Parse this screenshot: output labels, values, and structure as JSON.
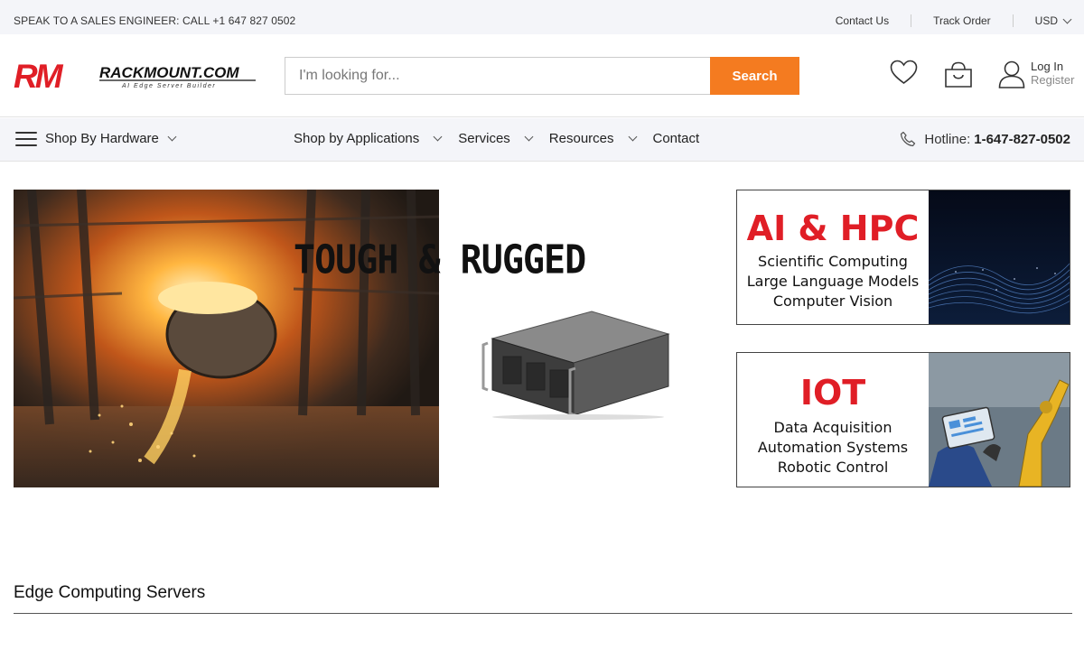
{
  "topbar": {
    "promo": "SPEAK TO A SALES ENGINEER: CALL +1 647 827 0502",
    "contact_us": "Contact Us",
    "track_order": "Track Order",
    "currency": "USD"
  },
  "header": {
    "logo_text": "RACKMOUNT.COM",
    "logo_mark": "RM",
    "logo_tagline": "AI Edge Server Builder",
    "search_placeholder": "I'm looking for...",
    "search_button": "Search",
    "login": "Log In",
    "register": "Register"
  },
  "nav": {
    "shop_by_hardware": "Shop By Hardware",
    "items": [
      "Shop by Applications",
      "Services",
      "Resources",
      "Contact"
    ],
    "hotline_label": "Hotline:",
    "hotline_number": "1-647-827-0502"
  },
  "hero": {
    "tagline": "TOUGH & RUGGED"
  },
  "cards": [
    {
      "title": "AI & HPC",
      "lines": [
        "Scientific Computing",
        "Large Language Models",
        "Computer Vision"
      ]
    },
    {
      "title": "IOT",
      "lines": [
        "Data Acquisition",
        "Automation Systems",
        "Robotic Control"
      ]
    }
  ],
  "section": {
    "title": "Edge Computing Servers"
  },
  "colors": {
    "accent": "#f47b20",
    "brand_red": "#e01e26",
    "topbar_bg": "#f4f5f9"
  }
}
